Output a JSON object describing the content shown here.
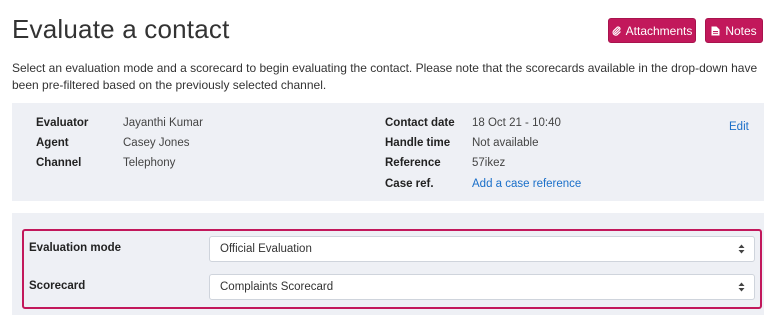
{
  "page": {
    "title": "Evaluate a contact",
    "intro": "Select an evaluation mode and a scorecard to begin evaluating the contact. Please note that the scorecards available in the drop-down have been pre-filtered based on the previously selected channel."
  },
  "toolbar": {
    "attachments_label": "Attachments",
    "notes_label": "Notes",
    "attachments_icon": "paperclip-icon",
    "notes_icon": "document-icon",
    "accent_color": "#c2185b"
  },
  "contact_info": {
    "evaluator_label": "Evaluator",
    "evaluator_value": "Jayanthi Kumar",
    "agent_label": "Agent",
    "agent_value": "Casey Jones",
    "channel_label": "Channel",
    "channel_value": "Telephony",
    "contact_date_label": "Contact date",
    "contact_date_value": "18 Oct 21 - 10:40",
    "handle_time_label": "Handle time",
    "handle_time_value": "Not available",
    "reference_label": "Reference",
    "reference_value": "57ikez",
    "case_ref_label": "Case ref.",
    "case_ref_link": "Add a case reference",
    "edit_link": "Edit"
  },
  "form": {
    "evaluation_mode_label": "Evaluation mode",
    "evaluation_mode_value": "Official Evaluation",
    "scorecard_label": "Scorecard",
    "scorecard_value": "Complaints Scorecard"
  }
}
